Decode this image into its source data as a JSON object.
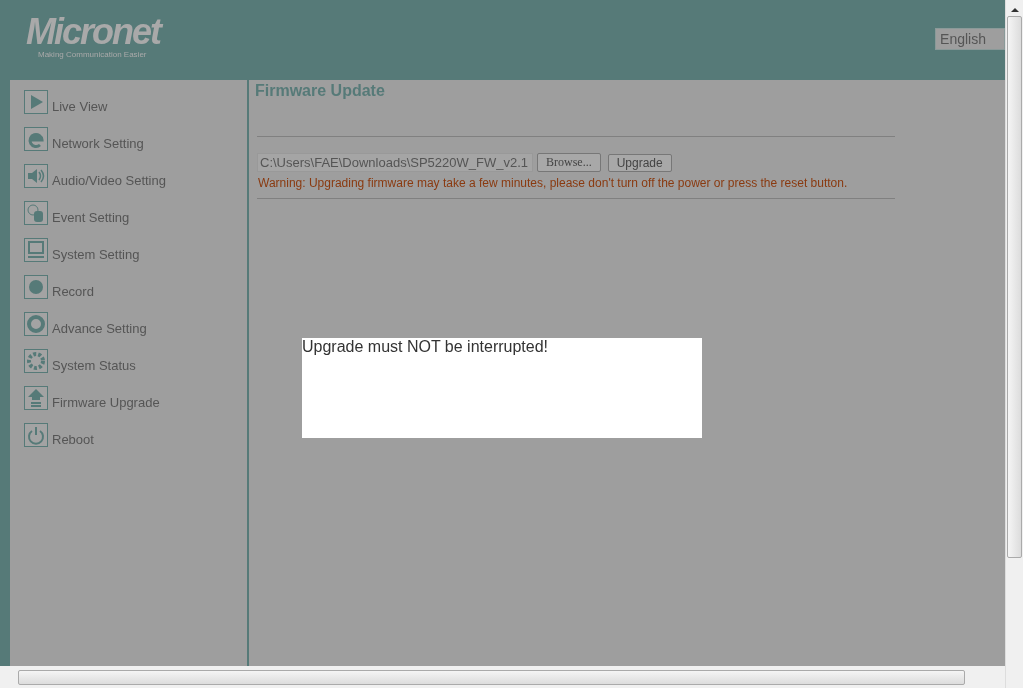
{
  "header": {
    "logo": "Micronet",
    "tagline": "Making Communication Easier",
    "language": "English"
  },
  "sidebar": {
    "items": [
      {
        "label": "Live View"
      },
      {
        "label": "Network Setting"
      },
      {
        "label": "Audio/Video Setting"
      },
      {
        "label": "Event Setting"
      },
      {
        "label": "System Setting"
      },
      {
        "label": "Record"
      },
      {
        "label": "Advance Setting"
      },
      {
        "label": "System Status"
      },
      {
        "label": "Firmware Upgrade"
      },
      {
        "label": "Reboot"
      }
    ]
  },
  "main": {
    "title": "Firmware Update",
    "file_path": "C:\\Users\\FAE\\Downloads\\SP5220W_FW_v2.1",
    "browse_button": "Browse...",
    "upgrade_button": "Upgrade",
    "warning": "Warning: Upgrading firmware may take a few minutes, please don't turn off the power or press the reset button."
  },
  "dialog": {
    "message": "Upgrade must NOT be interrupted!"
  }
}
